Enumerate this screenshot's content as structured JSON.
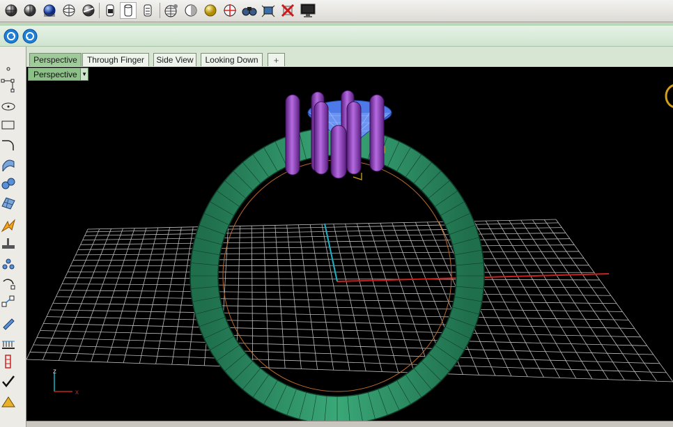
{
  "viewport_tabs": [
    {
      "label": "Perspective",
      "active": true
    },
    {
      "label": "Through Finger",
      "active": false
    },
    {
      "label": "Side View",
      "active": false
    },
    {
      "label": "Looking Down",
      "active": false
    }
  ],
  "add_tab_label": "+",
  "viewport": {
    "label": "Perspective",
    "axis_z_label": "z",
    "axis_x_label": "x"
  },
  "top_toolbar_icons": [
    "wireframe-sphere-icon",
    "shaded-sphere-icon",
    "rendered-sphere-icon",
    "ghosted-sphere-icon",
    "xray-sphere-icon",
    "lock-object-icon",
    "show-object-icon",
    "hide-object-icon",
    "grid-sphere-icon",
    "half-shaded-sphere-icon",
    "light-sphere-icon",
    "target-sphere-icon",
    "binoculars-icon",
    "camera-icon",
    "close-red-icon",
    "monitor-icon"
  ],
  "colors": {
    "ring_band": "#2b8a5f",
    "prongs": "#8a35b5",
    "gem": "#4d7ae8",
    "grid": "#bdbdbd",
    "x_axis": "#c8231d",
    "y_axis": "#19b4c8"
  }
}
